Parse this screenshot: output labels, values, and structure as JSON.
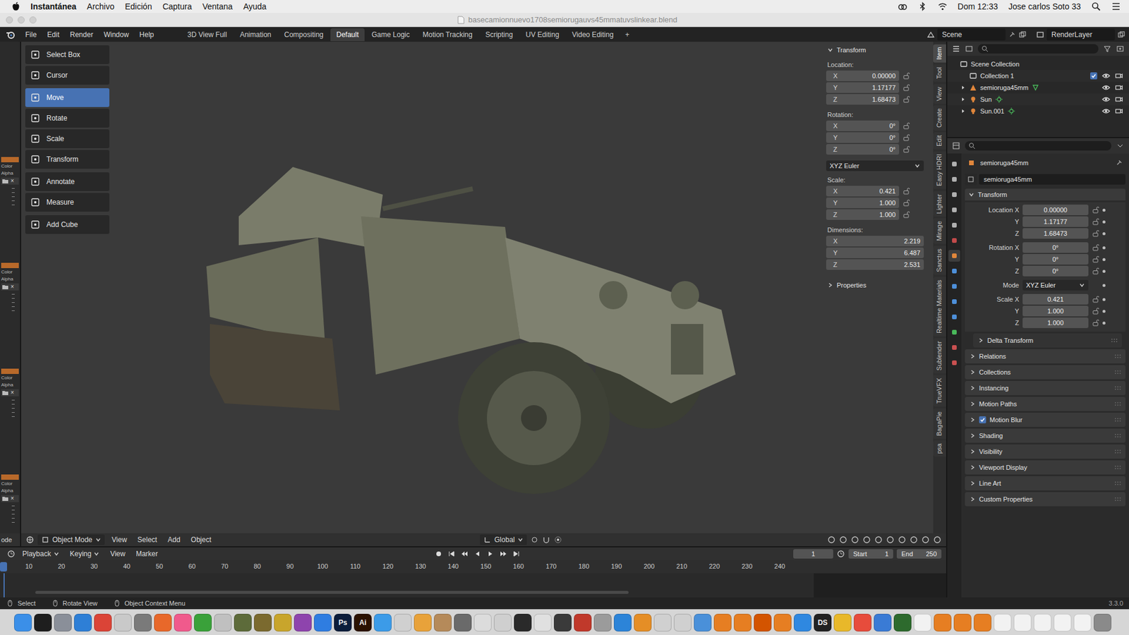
{
  "menubar": {
    "app": "Instantánea",
    "menus": [
      "Archivo",
      "Edición",
      "Captura",
      "Ventana",
      "Ayuda"
    ],
    "clock": "Dom 12:33",
    "user": "Jose carlos Soto 33"
  },
  "window": {
    "title": "basecamionnuevo1708semiorugauvs45mmatuvslinkear.blend"
  },
  "topbar": {
    "menus": [
      "File",
      "Edit",
      "Render",
      "Window",
      "Help"
    ],
    "workspaces": [
      {
        "label": "3D View Full",
        "selected": false
      },
      {
        "label": "Animation",
        "selected": false
      },
      {
        "label": "Compositing",
        "selected": false
      },
      {
        "label": "Default",
        "selected": true
      },
      {
        "label": "Game Logic",
        "selected": false
      },
      {
        "label": "Motion Tracking",
        "selected": false
      },
      {
        "label": "Scripting",
        "selected": false
      },
      {
        "label": "UV Editing",
        "selected": false
      },
      {
        "label": "Video Editing",
        "selected": false
      }
    ],
    "add_tab": "+",
    "scene": "Scene",
    "view_layer": "RenderLayer"
  },
  "left_strip": {
    "panels": [
      {
        "color": "#b8692a",
        "labels": [
          "Color",
          "Alpha"
        ],
        "close": "×"
      },
      {
        "color": "#b8692a",
        "labels": [
          "Color",
          "Alpha"
        ],
        "close": "×"
      },
      {
        "color": "#b8692a",
        "labels": [
          "Color",
          "Alpha"
        ],
        "close": "×"
      },
      {
        "color": "#b8692a",
        "labels": [
          "Color",
          "Alpha"
        ],
        "close": "×"
      }
    ],
    "header": "ode"
  },
  "toolbar": {
    "groups": [
      [
        {
          "label": "Select Box",
          "selected": false
        },
        {
          "label": "Cursor",
          "selected": false
        }
      ],
      [
        {
          "label": "Move",
          "selected": true
        },
        {
          "label": "Rotate",
          "selected": false
        },
        {
          "label": "Scale",
          "selected": false
        },
        {
          "label": "Transform",
          "selected": false
        }
      ],
      [
        {
          "label": "Annotate",
          "selected": false
        },
        {
          "label": "Measure",
          "selected": false
        }
      ],
      [
        {
          "label": "Add Cube",
          "selected": false
        }
      ]
    ]
  },
  "sidebar": {
    "title": "Transform",
    "location": {
      "label": "Location:",
      "fields": [
        {
          "axis": "X",
          "value": "0.00000",
          "locked": false
        },
        {
          "axis": "Y",
          "value": "1.17177",
          "locked": false
        },
        {
          "axis": "Z",
          "value": "1.68473",
          "locked": false
        }
      ]
    },
    "rotation": {
      "label": "Rotation:",
      "fields": [
        {
          "axis": "X",
          "value": "0°",
          "locked": false
        },
        {
          "axis": "Y",
          "value": "0°",
          "locked": false
        },
        {
          "axis": "Z",
          "value": "0°",
          "locked": false
        }
      ]
    },
    "rotation_mode": "XYZ Euler",
    "scale": {
      "label": "Scale:",
      "fields": [
        {
          "axis": "X",
          "value": "0.421",
          "locked": false
        },
        {
          "axis": "Y",
          "value": "1.000",
          "locked": false
        },
        {
          "axis": "Z",
          "value": "1.000",
          "locked": false
        }
      ]
    },
    "dimensions": {
      "label": "Dimensions:",
      "fields": [
        {
          "axis": "X",
          "value": "2.219"
        },
        {
          "axis": "Y",
          "value": "6.487"
        },
        {
          "axis": "Z",
          "value": "2.531"
        }
      ]
    },
    "properties": "Properties",
    "tabs": [
      {
        "label": "Item",
        "selected": true
      },
      {
        "label": "Tool",
        "selected": false
      },
      {
        "label": "View",
        "selected": false
      },
      {
        "label": "Create",
        "selected": false
      },
      {
        "label": "Edit",
        "selected": false
      },
      {
        "label": "Easy HDRI",
        "selected": false
      },
      {
        "label": "Lighter",
        "selected": false
      },
      {
        "label": "Mirage",
        "selected": false
      },
      {
        "label": "Sanctus",
        "selected": false
      },
      {
        "label": "Realtime Materials",
        "selected": false
      },
      {
        "label": "Sublender",
        "selected": false
      },
      {
        "label": "TrueVFX",
        "selected": false
      },
      {
        "label": "BagaPie",
        "selected": false
      },
      {
        "label": "psa",
        "selected": false
      }
    ]
  },
  "viewport_header": {
    "mode": "Object Mode",
    "menus": [
      "View",
      "Select",
      "Add",
      "Object"
    ],
    "orientation": "Global"
  },
  "timeline": {
    "menus": [
      {
        "label": "Playback",
        "dropdown": true
      },
      {
        "label": "Keying",
        "dropdown": true
      },
      {
        "label": "View",
        "dropdown": false
      },
      {
        "label": "Marker",
        "dropdown": false
      }
    ],
    "current": "1",
    "start_label": "Start",
    "start": "1",
    "end_label": "End",
    "end": "250",
    "ticks": [
      "10",
      "20",
      "30",
      "40",
      "50",
      "60",
      "70",
      "80",
      "90",
      "100",
      "110",
      "120",
      "130",
      "140",
      "150",
      "160",
      "170",
      "180",
      "190",
      "200",
      "210",
      "220",
      "230",
      "240"
    ]
  },
  "outliner": {
    "items": [
      {
        "label": "Scene Collection",
        "kind": "scene",
        "depth": 0,
        "expandable": false,
        "expanded": true
      },
      {
        "label": "Collection 1",
        "kind": "collection",
        "depth": 1,
        "expandable": false,
        "expanded": true,
        "checked": true,
        "visible": true
      },
      {
        "label": "semioruga45mm",
        "kind": "mesh",
        "depth": 1,
        "expandable": true,
        "expanded": false,
        "visible": true
      },
      {
        "label": "Sun",
        "kind": "light",
        "depth": 1,
        "expandable": true,
        "expanded": false,
        "visible": true
      },
      {
        "label": "Sun.001",
        "kind": "light",
        "depth": 1,
        "expandable": true,
        "expanded": false,
        "visible": true
      }
    ]
  },
  "properties": {
    "object": "semioruga45mm",
    "data_block": "semioruga45mm",
    "panel": "Transform",
    "groups": [
      [
        {
          "label": "Location X",
          "value": "0.00000",
          "kind": "number",
          "locked": false
        },
        {
          "label": "Y",
          "value": "1.17177",
          "kind": "number",
          "locked": false
        },
        {
          "label": "Z",
          "value": "1.68473",
          "kind": "number",
          "locked": false
        }
      ],
      [
        {
          "label": "Rotation X",
          "value": "0°",
          "kind": "number",
          "locked": false
        },
        {
          "label": "Y",
          "value": "0°",
          "kind": "number",
          "locked": false
        },
        {
          "label": "Z",
          "value": "0°",
          "kind": "number",
          "locked": false
        }
      ],
      [
        {
          "label": "Mode",
          "value": "XYZ Euler",
          "kind": "dropdown",
          "locked": false
        }
      ],
      [
        {
          "label": "Scale X",
          "value": "0.421",
          "kind": "number",
          "locked": false
        },
        {
          "label": "Y",
          "value": "1.000",
          "kind": "number",
          "locked": false
        },
        {
          "label": "Z",
          "value": "1.000",
          "kind": "number",
          "locked": false
        }
      ]
    ],
    "panels": [
      {
        "label": "Delta Transform",
        "kind": "subpanel",
        "expanded": false
      },
      {
        "label": "Relations",
        "kind": "panel",
        "expanded": false
      },
      {
        "label": "Collections",
        "kind": "panel",
        "expanded": false
      },
      {
        "label": "Instancing",
        "kind": "panel",
        "expanded": false
      },
      {
        "label": "Motion Paths",
        "kind": "panel",
        "expanded": false
      },
      {
        "label": "Motion Blur",
        "kind": "checkbox",
        "checked": true,
        "expanded": false
      },
      {
        "label": "Shading",
        "kind": "panel",
        "expanded": false
      },
      {
        "label": "Visibility",
        "kind": "panel",
        "expanded": false
      },
      {
        "label": "Viewport Display",
        "kind": "panel",
        "expanded": false
      },
      {
        "label": "Line Art",
        "kind": "panel",
        "expanded": false
      },
      {
        "label": "Custom Properties",
        "kind": "panel",
        "expanded": false
      }
    ],
    "tabs": [
      {
        "selected": false,
        "color": "#b0b0b0"
      },
      {
        "selected": false,
        "color": "#b0b0b0"
      },
      {
        "selected": false,
        "color": "#b0b0b0"
      },
      {
        "selected": false,
        "color": "#b0b0b0"
      },
      {
        "selected": false,
        "color": "#b0b0b0"
      },
      {
        "selected": false,
        "color": "#c24a4a"
      },
      {
        "selected": true,
        "color": "#e0863b"
      },
      {
        "selected": false,
        "color": "#4d8fd9"
      },
      {
        "selected": false,
        "color": "#4d8fd9"
      },
      {
        "selected": false,
        "color": "#4d8fd9"
      },
      {
        "selected": false,
        "color": "#4d8fd9"
      },
      {
        "selected": false,
        "color": "#49b85a"
      },
      {
        "selected": false,
        "color": "#c95050"
      },
      {
        "selected": false,
        "color": "#c95050"
      }
    ]
  },
  "statusbar": {
    "hints": [
      "Select",
      "Rotate View",
      "Object Context Menu"
    ],
    "version": "3.3.0"
  },
  "dock": [
    {
      "color": "#3b8fe8"
    },
    {
      "color": "#1e1e1e"
    },
    {
      "color": "#8a8f99"
    },
    {
      "color": "#2e7fd6"
    },
    {
      "color": "#db4437"
    },
    {
      "color": "#c9c9c9"
    },
    {
      "color": "#7a7a7a"
    },
    {
      "color": "#e8682a"
    },
    {
      "color": "#f05a8c"
    },
    {
      "color": "#3aa13a"
    },
    {
      "color": "#c0c0c0"
    },
    {
      "color": "#5d6b3a"
    },
    {
      "color": "#7b6a2f"
    },
    {
      "color": "#c8a52c"
    },
    {
      "color": "#8e44ad"
    },
    {
      "color": "#2f7de1"
    },
    {
      "color": "#0c1d3b",
      "label": "Ps"
    },
    {
      "color": "#2b1200",
      "label": "Ai"
    },
    {
      "color": "#3c9be8"
    },
    {
      "color": "#d0d0d0"
    },
    {
      "color": "#e8a23a"
    },
    {
      "color": "#b58a5a"
    },
    {
      "color": "#6a6a6a"
    },
    {
      "color": "#dcdcdc"
    },
    {
      "color": "#cfcfcf"
    },
    {
      "color": "#2a2a2a"
    },
    {
      "color": "#e0e0e0"
    },
    {
      "color": "#3a3a3a"
    },
    {
      "color": "#c0392b"
    },
    {
      "color": "#9b9b9b"
    },
    {
      "color": "#2c84d8"
    },
    {
      "color": "#e58e26"
    },
    {
      "color": "#d0d0d0"
    },
    {
      "color": "#d0d0d0"
    },
    {
      "color": "#4a90d9"
    },
    {
      "color": "#e67e22"
    },
    {
      "color": "#e67e22"
    },
    {
      "color": "#d35400"
    },
    {
      "color": "#e67e22"
    },
    {
      "color": "#2f88e0"
    },
    {
      "color": "#222222",
      "label": "DS"
    },
    {
      "color": "#e8b82a"
    },
    {
      "color": "#e74c3c"
    },
    {
      "color": "#3a7bd5"
    },
    {
      "color": "#2d6a2d"
    },
    {
      "color": "#f2f2f2"
    },
    {
      "color": "#e67e22"
    },
    {
      "color": "#e67e22"
    },
    {
      "color": "#e67e22"
    },
    {
      "color": "#f2f2f2"
    },
    {
      "color": "#f2f2f2"
    },
    {
      "color": "#f2f2f2"
    },
    {
      "color": "#f2f2f2"
    },
    {
      "color": "#f2f2f2"
    },
    {
      "color": "#8a8a8a"
    }
  ]
}
